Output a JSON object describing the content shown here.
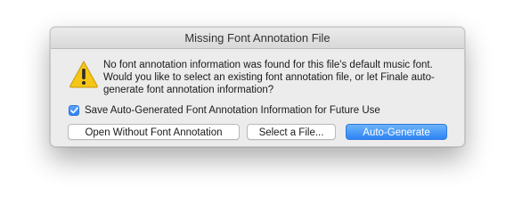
{
  "dialog": {
    "title": "Missing Font Annotation File",
    "message": "No font annotation information was found for this file's default music font. Would you like to select an existing font annotation file, or let Finale auto-generate font annotation information?",
    "icon": "warning-icon",
    "checkbox": {
      "label": "Save Auto-Generated Font Annotation Information for Future Use",
      "checked": true
    },
    "buttons": {
      "open_without": "Open Without Font Annotation",
      "select_file": "Select a File...",
      "auto_generate": "Auto-Generate"
    }
  },
  "colors": {
    "accent": "#2d84f4",
    "warning_yellow": "#f5c518",
    "dialog_bg": "#ececec"
  }
}
